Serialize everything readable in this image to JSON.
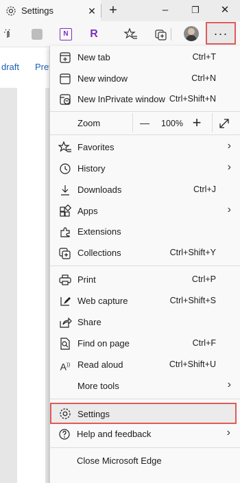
{
  "tab": {
    "title": "Settings"
  },
  "window": {
    "minimize": "–",
    "restore": "❐",
    "close": "✕"
  },
  "page": {
    "link1": "draft",
    "link2": "Prev"
  },
  "menu": {
    "new_tab": {
      "label": "New tab",
      "shortcut": "Ctrl+T"
    },
    "new_window": {
      "label": "New window",
      "shortcut": "Ctrl+N"
    },
    "new_inprivate": {
      "label": "New InPrivate window",
      "shortcut": "Ctrl+Shift+N"
    },
    "zoom": {
      "label": "Zoom",
      "minus": "—",
      "value": "100%",
      "plus": "+"
    },
    "favorites": {
      "label": "Favorites"
    },
    "history": {
      "label": "History"
    },
    "downloads": {
      "label": "Downloads",
      "shortcut": "Ctrl+J"
    },
    "apps": {
      "label": "Apps"
    },
    "extensions": {
      "label": "Extensions"
    },
    "collections": {
      "label": "Collections",
      "shortcut": "Ctrl+Shift+Y"
    },
    "print": {
      "label": "Print",
      "shortcut": "Ctrl+P"
    },
    "web_capture": {
      "label": "Web capture",
      "shortcut": "Ctrl+Shift+S"
    },
    "share": {
      "label": "Share"
    },
    "find_on_page": {
      "label": "Find on page",
      "shortcut": "Ctrl+F"
    },
    "read_aloud": {
      "label": "Read aloud",
      "shortcut": "Ctrl+Shift+U"
    },
    "more_tools": {
      "label": "More tools"
    },
    "settings": {
      "label": "Settings"
    },
    "help": {
      "label": "Help and feedback"
    },
    "close_edge": {
      "label": "Close Microsoft Edge"
    }
  },
  "toolbar": {
    "onenote_letters": "N",
    "r_letter": "R",
    "more": "···"
  },
  "colors": {
    "highlight_border": "#e05a5a",
    "onenote": "#7b2fbe",
    "r_icon": "#7b2fbe"
  },
  "icons": [
    "settings-gear-icon",
    "close-icon",
    "new-tab-plus-icon",
    "minimize-icon",
    "restore-icon",
    "window-close-icon",
    "touch-icon",
    "puzzle-icon",
    "onenote-icon",
    "r-extension-icon",
    "favorites-star-icon",
    "collections-icon",
    "profile-avatar",
    "more-icon"
  ]
}
